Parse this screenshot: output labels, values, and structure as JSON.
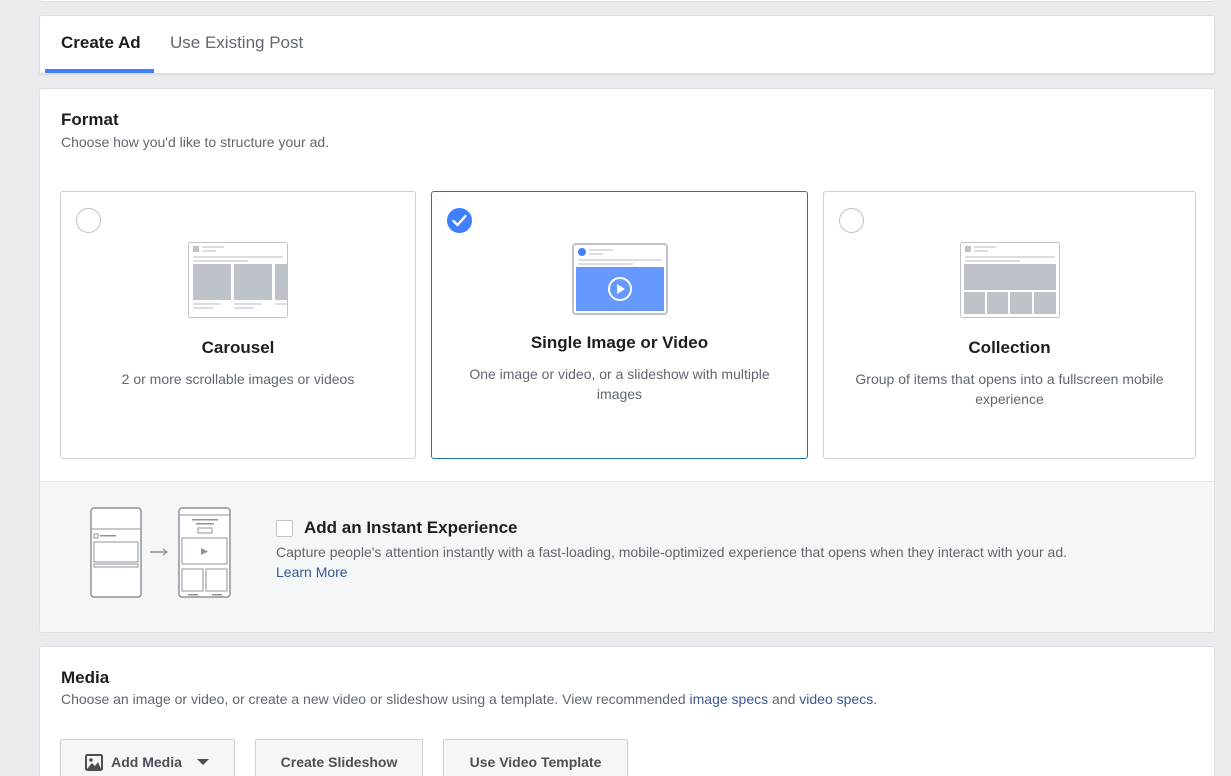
{
  "tabs": {
    "create_ad": "Create Ad",
    "use_existing": "Use Existing Post",
    "active": "Create Ad"
  },
  "format": {
    "title": "Format",
    "subtitle": "Choose how you'd like to structure your ad.",
    "options": [
      {
        "name": "Carousel",
        "description": "2 or more scrollable images or videos",
        "selected": false,
        "icon": "carousel-illustration"
      },
      {
        "name": "Single Image or Video",
        "description": "One image or video, or a slideshow with multiple images",
        "selected": true,
        "icon": "single-image-illustration"
      },
      {
        "name": "Collection",
        "description": "Group of items that opens into a fullscreen mobile experience",
        "selected": false,
        "icon": "collection-illustration"
      }
    ]
  },
  "instant_experience": {
    "title": "Add an Instant Experience",
    "description": "Capture people's attention instantly with a fast-loading, mobile-optimized experience that opens when they interact with your ad.",
    "learn_more": "Learn More",
    "checked": false
  },
  "media": {
    "title": "Media",
    "subtitle_prefix": "Choose an image or video, or create a new video or slideshow using a template. View recommended ",
    "image_specs_link": "image specs",
    "and": " and ",
    "video_specs_link": "video specs",
    "period": ".",
    "buttons": {
      "add_media": "Add Media",
      "create_slideshow": "Create Slideshow",
      "use_video_template": "Use Video Template"
    }
  },
  "colors": {
    "accent": "#4080ff",
    "selected_border": "#1d7aa0",
    "link": "#385898"
  }
}
